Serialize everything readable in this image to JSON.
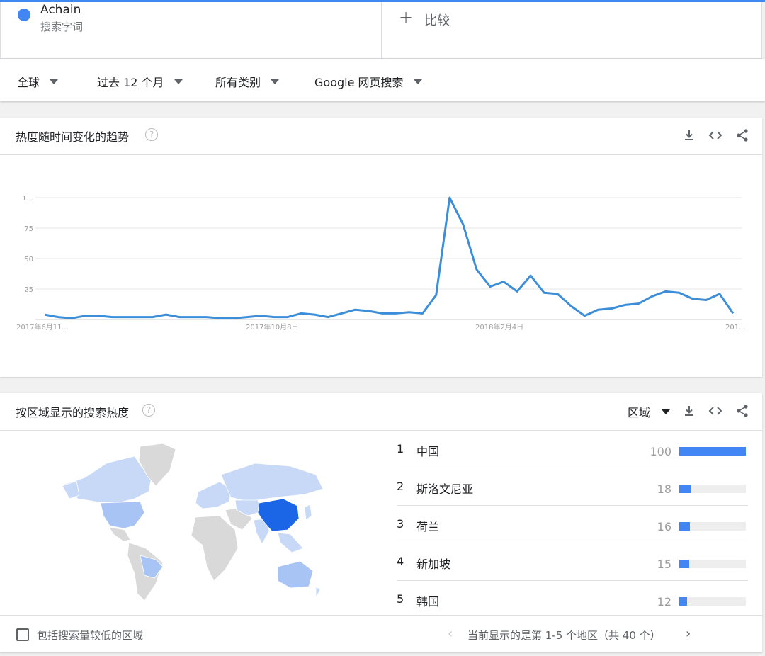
{
  "term": {
    "name": "Achain",
    "subtitle": "搜索字词",
    "color": "#4285f4"
  },
  "compare": {
    "label": "比较"
  },
  "filters": [
    {
      "label": "全球"
    },
    {
      "label": "过去 12 个月"
    },
    {
      "label": "所有类别"
    },
    {
      "label": "Google 网页搜索"
    }
  ],
  "trend": {
    "title": "热度随时间变化的趋势",
    "icons": [
      "download-icon",
      "embed-icon",
      "share-icon"
    ]
  },
  "chart_data": {
    "type": "line",
    "ylim": [
      0,
      100
    ],
    "y_ticks": [
      {
        "v": 25,
        "label": "25"
      },
      {
        "v": 50,
        "label": "50"
      },
      {
        "v": 75,
        "label": "75"
      },
      {
        "v": 100,
        "label": "1..."
      }
    ],
    "x_ticks": [
      {
        "i": 0,
        "label": "2017年6月11..."
      },
      {
        "i": 17,
        "label": "2017年10月8日"
      },
      {
        "i": 34,
        "label": "2018年2月4日"
      },
      {
        "i": 51,
        "label": "201..."
      }
    ],
    "series": [
      {
        "color": "#3d8ed9",
        "values": [
          4,
          2,
          1,
          3,
          3,
          2,
          2,
          2,
          2,
          4,
          2,
          2,
          2,
          1,
          1,
          2,
          3,
          2,
          2,
          5,
          4,
          2,
          5,
          8,
          7,
          5,
          5,
          6,
          5,
          20,
          100,
          78,
          41,
          27,
          31,
          23,
          36,
          22,
          21,
          11,
          3,
          8,
          9,
          12,
          13,
          19,
          23,
          22,
          17,
          16,
          21,
          5
        ]
      }
    ]
  },
  "region": {
    "title": "按区域显示的搜索热度",
    "dropdown": "区域",
    "rows": [
      {
        "rank": "1",
        "name": "中国",
        "value": 100
      },
      {
        "rank": "2",
        "name": "斯洛文尼亚",
        "value": 18
      },
      {
        "rank": "3",
        "name": "荷兰",
        "value": 16
      },
      {
        "rank": "4",
        "name": "新加坡",
        "value": 15
      },
      {
        "rank": "5",
        "name": "韩国",
        "value": 12
      }
    ],
    "low_volume_label": "包括搜索量较低的区域",
    "pager_text": "当前显示的是第 1-5 个地区（共 40 个）",
    "map_colors": {
      "high": "#1a66e6",
      "mid": "#a8c4f4",
      "low": "#c7d9f7",
      "none": "#d9d9d9"
    }
  }
}
